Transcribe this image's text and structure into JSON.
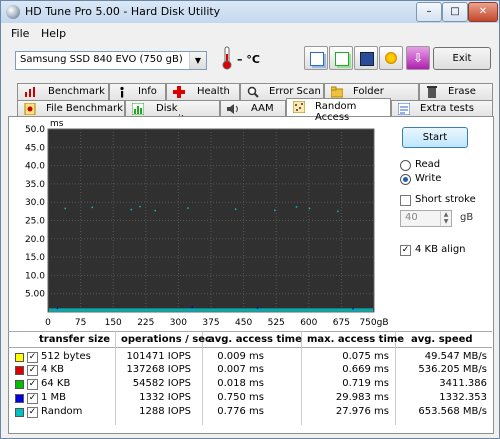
{
  "window": {
    "title": "HD Tune Pro 5.00 - Hard Disk Utility"
  },
  "menu": {
    "file": "File",
    "help": "Help"
  },
  "toolbar": {
    "drive": "Samsung SSD 840 EVO   (750 gB)",
    "temperature": "– °C",
    "exit_label": "Exit",
    "button_icons": [
      "copy-info-icon",
      "copy-screenshot-icon",
      "save-icon",
      "options-icon",
      "download-icon"
    ]
  },
  "tabs_row1": [
    {
      "label": "Benchmark",
      "icon": "benchmark-icon"
    },
    {
      "label": "Info",
      "icon": "info-icon"
    },
    {
      "label": "Health",
      "icon": "health-icon"
    },
    {
      "label": "Error Scan",
      "icon": "error-scan-icon"
    },
    {
      "label": "Folder Usage",
      "icon": "folder-icon"
    },
    {
      "label": "Erase",
      "icon": "erase-icon"
    }
  ],
  "tabs_row2": [
    {
      "label": "File Benchmark",
      "icon": "file-benchmark-icon"
    },
    {
      "label": "Disk monitor",
      "icon": "disk-monitor-icon"
    },
    {
      "label": "AAM",
      "icon": "speaker-icon"
    },
    {
      "label": "Random Access",
      "icon": "random-access-icon",
      "active": true
    },
    {
      "label": "Extra tests",
      "icon": "extra-tests-icon"
    }
  ],
  "controls": {
    "start_label": "Start",
    "read_label": "Read",
    "write_label": "Write",
    "mode": "Write",
    "short_stroke_label": "Short stroke",
    "short_stroke_checked": false,
    "short_stroke_value": "40",
    "short_stroke_unit": "gB",
    "align_label": "4 KB align",
    "align_checked": true
  },
  "table": {
    "headers": [
      "transfer size",
      "operations / sec",
      "avg. access time",
      "max. access time",
      "avg. speed"
    ],
    "rows": [
      {
        "size": "512 bytes",
        "color": "#ffff00",
        "ops": "101471 IOPS",
        "avg_access": "0.009 ms",
        "max_access": "0.075 ms",
        "avg_speed": "49.547 MB/s"
      },
      {
        "size": "4 KB",
        "color": "#e00000",
        "ops": "137268 IOPS",
        "avg_access": "0.007 ms",
        "max_access": "0.669 ms",
        "avg_speed": "536.205 MB/s"
      },
      {
        "size": "64 KB",
        "color": "#00c000",
        "ops": "54582 IOPS",
        "avg_access": "0.018 ms",
        "max_access": "0.719 ms",
        "avg_speed": "3411.386"
      },
      {
        "size": "1 MB",
        "color": "#0000e0",
        "ops": "1332 IOPS",
        "avg_access": "0.750 ms",
        "max_access": "29.983 ms",
        "avg_speed": "1332.353"
      },
      {
        "size": "Random",
        "color": "#00c0c0",
        "ops": "1288 IOPS",
        "avg_access": "0.776 ms",
        "max_access": "27.976 ms",
        "avg_speed": "653.568 MB/s"
      }
    ]
  },
  "chart_data": {
    "type": "scatter",
    "ylabel": "ms",
    "y_ticks": [
      "50.0",
      "45.0",
      "40.0",
      "35.0",
      "30.0",
      "25.0",
      "20.0",
      "15.0",
      "10.0",
      "5.00"
    ],
    "x_ticks": [
      "0",
      "75",
      "150",
      "225",
      "300",
      "375",
      "450",
      "525",
      "600",
      "675",
      "750gB"
    ],
    "xlim": [
      0,
      750
    ],
    "ylim": [
      0,
      50
    ],
    "grid": true,
    "background": "#303030",
    "series": [
      {
        "color": "#00c0c0",
        "band": [
          0.1,
          1.0
        ]
      },
      {
        "color": "#00c0c0",
        "sparse": [
          [
            38,
            28.5
          ],
          [
            100,
            28.8
          ],
          [
            190,
            28.2
          ],
          [
            245,
            27.9
          ],
          [
            320,
            28.6
          ],
          [
            430,
            28.3
          ],
          [
            520,
            28.0
          ],
          [
            600,
            28.5
          ],
          [
            665,
            27.7
          ],
          [
            210,
            29.0
          ],
          [
            570,
            28.9
          ]
        ]
      },
      {
        "color": "#0000e0",
        "sparse": [
          [
            20,
            1.2
          ],
          [
            330,
            1.5
          ],
          [
            480,
            1.3
          ],
          [
            700,
            1.1
          ]
        ]
      }
    ]
  }
}
